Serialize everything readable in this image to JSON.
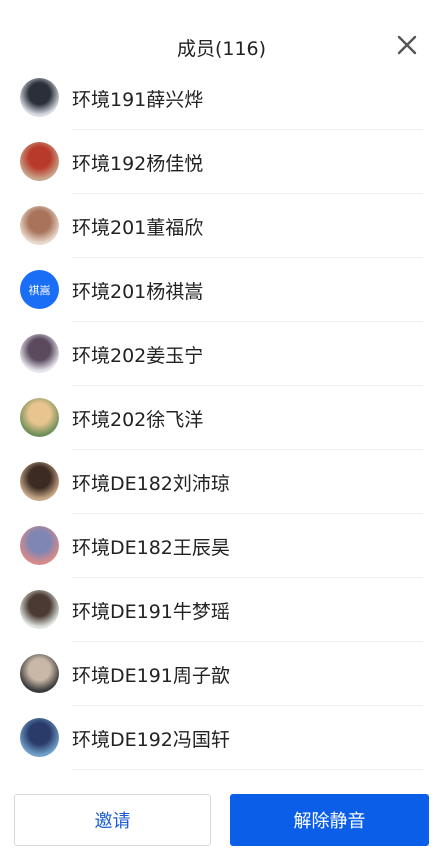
{
  "header": {
    "title": "成员(116)"
  },
  "members": [
    {
      "name": "环境191薛兴烨",
      "avatar": {
        "type": "image",
        "icon": "photo-avatar-icon",
        "colors": [
          "#d8dde3",
          "#2a2f3a"
        ]
      }
    },
    {
      "name": "环境192杨佳悦",
      "avatar": {
        "type": "image",
        "icon": "photo-avatar-icon",
        "colors": [
          "#c9a48a",
          "#b83a2a"
        ]
      }
    },
    {
      "name": "环境201董福欣",
      "avatar": {
        "type": "image",
        "icon": "photo-avatar-icon",
        "colors": [
          "#e9d8cc",
          "#a8735a"
        ]
      }
    },
    {
      "name": "环境201杨祺嵩",
      "avatar": {
        "type": "text",
        "text": "祺嵩",
        "colors": [
          "#1a6ef5",
          "#1a6ef5"
        ]
      }
    },
    {
      "name": "环境202姜玉宁",
      "avatar": {
        "type": "image",
        "icon": "photo-avatar-icon",
        "colors": [
          "#e6e6ec",
          "#5b4a5e"
        ]
      }
    },
    {
      "name": "环境202徐飞洋",
      "avatar": {
        "type": "image",
        "icon": "photo-avatar-icon",
        "colors": [
          "#6f8f5a",
          "#e8c48e"
        ]
      }
    },
    {
      "name": "环境DE182刘沛琼",
      "avatar": {
        "type": "image",
        "icon": "photo-avatar-icon",
        "colors": [
          "#c7a888",
          "#3b2b22"
        ]
      }
    },
    {
      "name": "环境DE182王辰昊",
      "avatar": {
        "type": "image",
        "icon": "photo-avatar-icon",
        "colors": [
          "#d88a8a",
          "#7f86b3"
        ]
      }
    },
    {
      "name": "环境DE191牛梦瑶",
      "avatar": {
        "type": "image",
        "icon": "photo-avatar-icon",
        "colors": [
          "#dfe4df",
          "#4a3a33"
        ]
      }
    },
    {
      "name": "环境DE191周子歆",
      "avatar": {
        "type": "image",
        "icon": "photo-avatar-icon",
        "colors": [
          "#3a3a3a",
          "#c9b8a8"
        ]
      }
    },
    {
      "name": "环境DE192冯国轩",
      "avatar": {
        "type": "image",
        "icon": "photo-avatar-icon",
        "colors": [
          "#6fa0c9",
          "#2a3b6a"
        ]
      }
    }
  ],
  "footer": {
    "invite_label": "邀请",
    "unmute_label": "解除静音"
  },
  "colors": {
    "primary": "#0a5ee8",
    "text_avatar_bg": "#1a6ef5",
    "text": "#222222"
  }
}
